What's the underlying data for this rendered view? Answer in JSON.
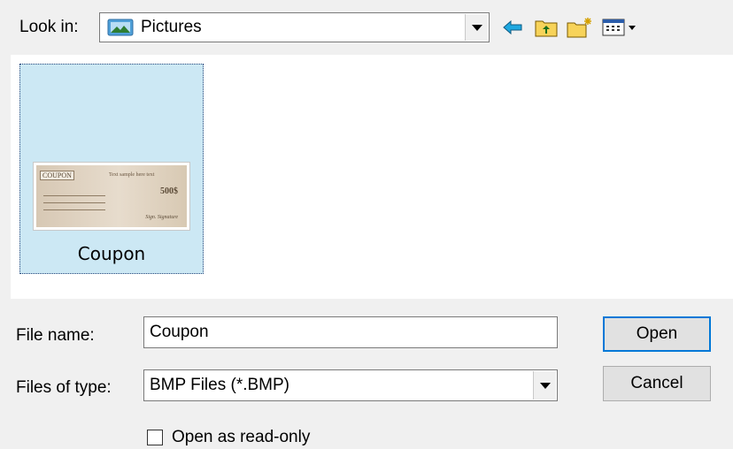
{
  "lookin": {
    "label": "Look in:",
    "value": "Pictures",
    "folder_icon": "pictures-folder-icon"
  },
  "toolbar": {
    "buttons": [
      {
        "name": "back-icon"
      },
      {
        "name": "up-folder-icon"
      },
      {
        "name": "new-folder-icon"
      },
      {
        "name": "view-menu-icon"
      }
    ]
  },
  "files": [
    {
      "name": "Coupon",
      "selected": true,
      "thumbnail": {
        "tag": "COUPON",
        "sample": "Text sample here text",
        "amount": "500$",
        "signature": "Sign. Signature"
      }
    }
  ],
  "form": {
    "filename_label": "File name:",
    "filename_value": "Coupon",
    "filetype_label": "Files of type:",
    "filetype_value": "BMP Files (*.BMP)",
    "readonly_label": "Open as read-only",
    "readonly_checked": false
  },
  "buttons": {
    "open": "Open",
    "cancel": "Cancel"
  },
  "colors": {
    "selection": "#cce8f4",
    "focus": "#0078d7",
    "back_arrow": "#1ea8e0",
    "folder": "#f2c23a"
  }
}
